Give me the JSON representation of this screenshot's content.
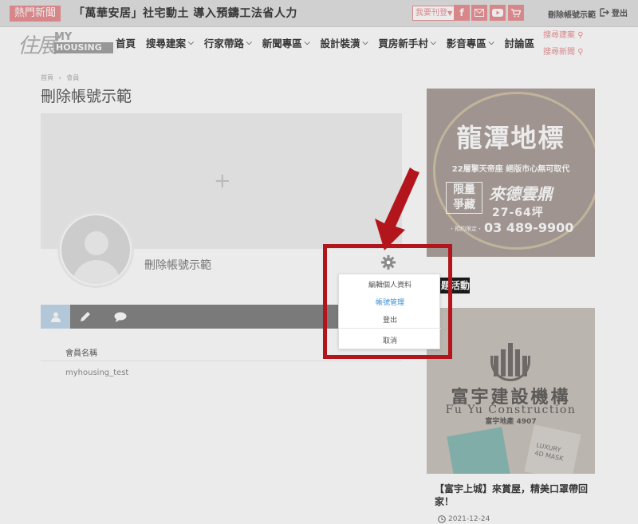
{
  "topbar": {
    "hot_label": "熱門新聞",
    "ticker": "「萬華安居」社宅動土 導入預鑄工法省人力",
    "publish_button": "我要刊登",
    "social_icons": [
      "facebook-icon",
      "mail-icon",
      "youtube-icon",
      "cart-icon"
    ],
    "username": "刪除帳號示範",
    "logout_label": "登出"
  },
  "header": {
    "logo": {
      "zh": "住展",
      "my": "MY",
      "housing": "HOUSING"
    },
    "nav": [
      {
        "label": "首頁",
        "dropdown": false
      },
      {
        "label": "搜尋建案",
        "dropdown": true
      },
      {
        "label": "行家帶路",
        "dropdown": true
      },
      {
        "label": "新聞專區",
        "dropdown": true
      },
      {
        "label": "設計裝潢",
        "dropdown": true
      },
      {
        "label": "買房新手村",
        "dropdown": true
      },
      {
        "label": "影音專區",
        "dropdown": true
      },
      {
        "label": "討論區",
        "dropdown": false
      }
    ],
    "search_links": [
      "搜尋建案",
      "搜尋新聞"
    ]
  },
  "breadcrumb": {
    "home": "首頁",
    "separator": "›",
    "current": "會員"
  },
  "page_title": "刪除帳號示範",
  "profile": {
    "name": "刪除帳號示範",
    "tabs": [
      {
        "icon": "user-icon",
        "active": true
      },
      {
        "icon": "pencil-icon",
        "active": false
      },
      {
        "icon": "comment-icon",
        "active": false
      }
    ],
    "field_label": "會員名稱",
    "field_value": "myhousing_test"
  },
  "dropdown_menu": {
    "items": [
      {
        "label": "編輯個人資料",
        "active": false
      },
      {
        "label": "帳號管理",
        "active": true
      },
      {
        "label": "登出",
        "active": false
      },
      {
        "label": "取消",
        "active": false
      }
    ]
  },
  "sidebar": {
    "ad1": {
      "title": "龍潭地標",
      "subtitle": "22層擎天帝座 絕版市心無可取代",
      "box": "限量\n爭藏",
      "brand": "來德雲鼎",
      "size": "27-64坪",
      "note": "・預約限定・",
      "phone": "03 489-9900"
    },
    "section_tag": "題活動",
    "ad2": {
      "title": "富宇建設機構",
      "english": "Fu Yu Construction",
      "sub": "富宇地產 4907",
      "pack_text": "LUXURY\n4D MASK"
    },
    "post": {
      "title": "【富宇上城】來賞屋，精美口罩帶回家！",
      "date": "2021-12-24"
    }
  },
  "colors": {
    "accent": "#e98e91",
    "highlight": "#b2151b",
    "link": "#3a8fd6",
    "tab_bar": "#7f7f7f"
  }
}
